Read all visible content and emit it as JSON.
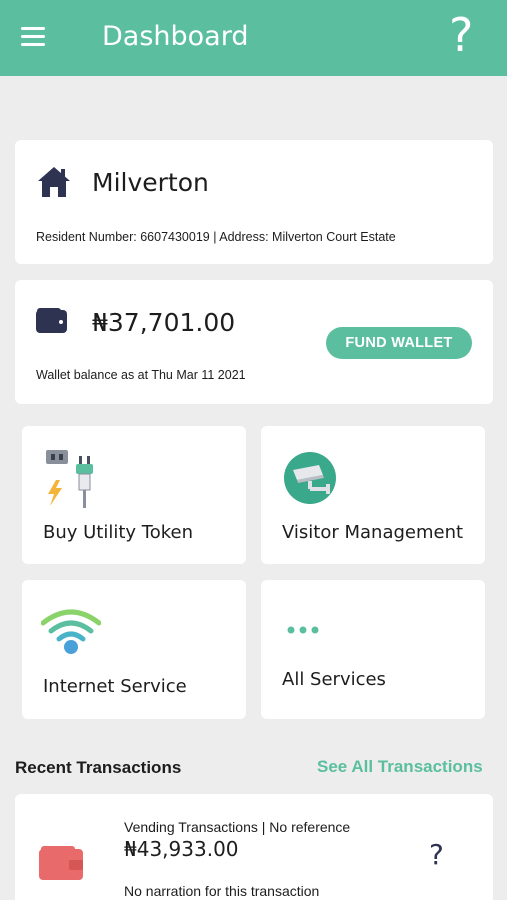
{
  "appbar": {
    "title": "Dashboard",
    "help_label": "?"
  },
  "estate": {
    "name": "Milverton",
    "details": "Resident Number: 6607430019 | Address: Milverton Court Estate"
  },
  "wallet": {
    "balance": "₦37,701.00",
    "fund_label": "FUND WALLET",
    "caption": "Wallet balance as at Thu Mar 11 2021"
  },
  "services": [
    {
      "label": "Buy Utility Token",
      "icon": "plug-icon"
    },
    {
      "label": "Visitor Management",
      "icon": "cctv-camera-icon"
    },
    {
      "label": "Internet Service",
      "icon": "wifi-icon"
    },
    {
      "label": "All Services",
      "icon": "more-dots-icon"
    }
  ],
  "recent": {
    "title": "Recent Transactions",
    "see_all": "See All Transactions",
    "transactions": [
      {
        "type": "Vending Transactions |  No reference",
        "amount": "₦43,933.00",
        "narration": "No narration for this transaction",
        "help": "?"
      }
    ]
  },
  "colors": {
    "accent": "#5bbf9f",
    "navy": "#2d3350",
    "wallet_red": "#e86a6a",
    "background": "#ededed"
  }
}
